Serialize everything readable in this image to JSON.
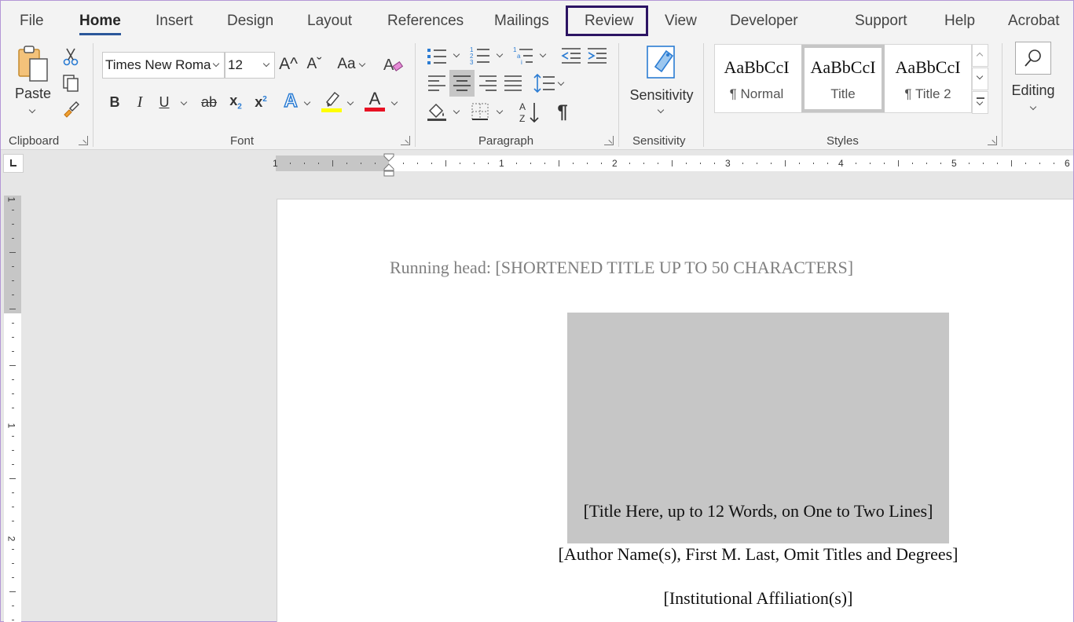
{
  "menu": {
    "tabs": [
      "File",
      "Home",
      "Insert",
      "Design",
      "Layout",
      "References",
      "Mailings",
      "Review",
      "View",
      "Developer",
      "Support",
      "Help",
      "Acrobat"
    ],
    "active": "Home",
    "highlighted": "Review"
  },
  "ribbon": {
    "clipboard": {
      "label": "Clipboard",
      "paste_label": "Paste"
    },
    "font": {
      "label": "Font",
      "font_name": "Times New Roma",
      "font_size": "12",
      "bold": "B",
      "italic": "I",
      "underline": "U",
      "strike": "ab",
      "change_case": "Aa",
      "text_effects": "A",
      "font_color": "A",
      "highlight_color": "#ffff00",
      "font_color_value": "#e81123"
    },
    "paragraph": {
      "label": "Paragraph",
      "show_marks": "¶"
    },
    "sensitivity": {
      "label": "Sensitivity",
      "button_label": "Sensitivity"
    },
    "styles": {
      "label": "Styles",
      "items": [
        {
          "sample": "AaBbCcI",
          "name": "¶ Normal"
        },
        {
          "sample": "AaBbCcI",
          "name": "Title"
        },
        {
          "sample": "AaBbCcI",
          "name": "¶ Title 2"
        }
      ],
      "selected": "Title"
    },
    "editing": {
      "label": "Editing"
    }
  },
  "ruler": {
    "horizontal_numbers": [
      "1",
      "1",
      "2",
      "3",
      "4",
      "5",
      "6"
    ],
    "vertical_numbers": [
      "1",
      "1",
      "2"
    ]
  },
  "document": {
    "running_head": "Running head: [SHORTENED TITLE UP TO 50 CHARACTERS]",
    "title": "[Title Here, up to 12 Words, on One to Two Lines]",
    "author": "[Author Name(s), First M. Last, Omit Titles and Degrees]",
    "affiliation": "[Institutional Affiliation(s)]"
  },
  "colors": {
    "accent": "#2b579a",
    "review_frame": "#2c1463"
  }
}
